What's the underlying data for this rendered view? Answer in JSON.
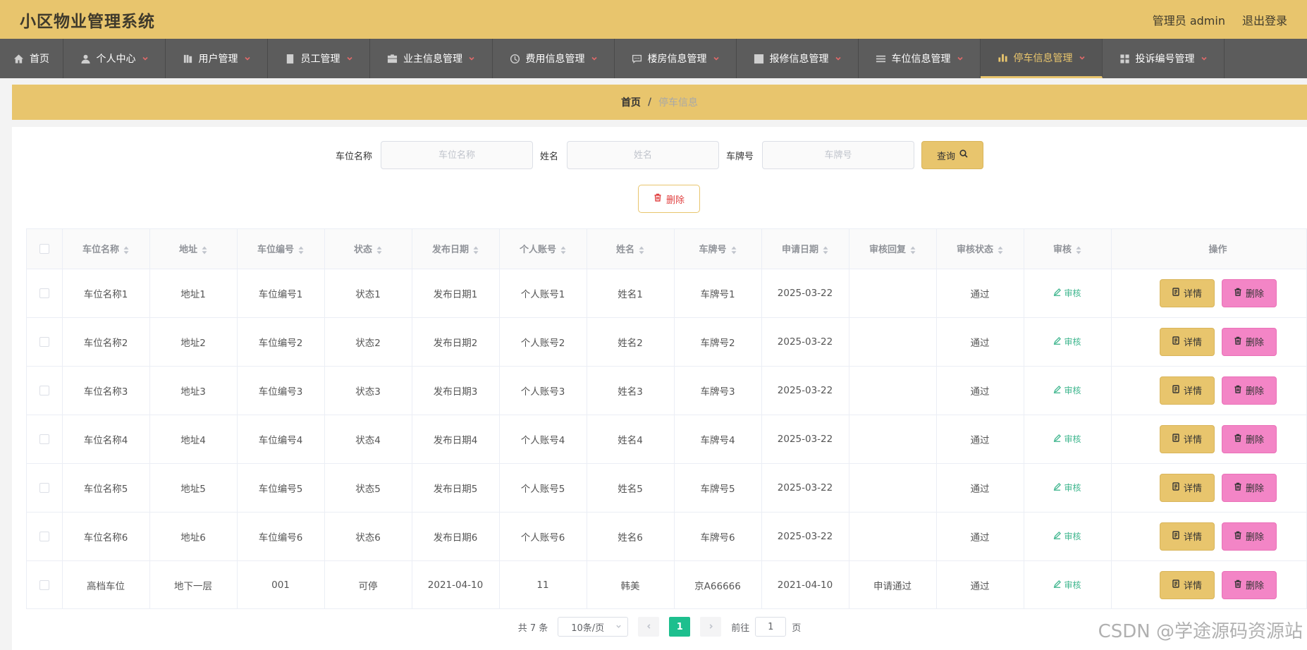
{
  "app": {
    "title": "小区物业管理系统"
  },
  "header": {
    "user": "管理员 admin",
    "logout": "退出登录"
  },
  "nav": [
    {
      "label": "首页",
      "icon": "home-icon",
      "dropdown": false
    },
    {
      "label": "个人中心",
      "icon": "user-icon",
      "dropdown": true
    },
    {
      "label": "用户管理",
      "icon": "book-icon",
      "dropdown": true
    },
    {
      "label": "员工管理",
      "icon": "badge-icon",
      "dropdown": true
    },
    {
      "label": "业主信息管理",
      "icon": "briefcase-icon",
      "dropdown": true
    },
    {
      "label": "费用信息管理",
      "icon": "clock-icon",
      "dropdown": true
    },
    {
      "label": "楼房信息管理",
      "icon": "chat-icon",
      "dropdown": true
    },
    {
      "label": "报修信息管理",
      "icon": "chart-line-icon",
      "dropdown": true
    },
    {
      "label": "车位信息管理",
      "icon": "menu-icon",
      "dropdown": true
    },
    {
      "label": "停车信息管理",
      "icon": "bar-chart-icon",
      "dropdown": true,
      "active": true
    },
    {
      "label": "投诉编号管理",
      "icon": "grid-icon",
      "dropdown": true
    }
  ],
  "breadcrumb": {
    "home": "首页",
    "separator": "/",
    "current": "停车信息"
  },
  "search": {
    "fields": [
      {
        "label": "车位名称",
        "placeholder": "车位名称",
        "value": ""
      },
      {
        "label": "姓名",
        "placeholder": "姓名",
        "value": ""
      },
      {
        "label": "车牌号",
        "placeholder": "车牌号",
        "value": ""
      }
    ],
    "query_label": "查询"
  },
  "bulk_delete_label": "删除",
  "table": {
    "columns": [
      "车位名称",
      "地址",
      "车位编号",
      "状态",
      "发布日期",
      "个人账号",
      "姓名",
      "车牌号",
      "申请日期",
      "审核回复",
      "审核状态",
      "审核",
      "操作"
    ],
    "review_label": "审核",
    "detail_label": "详情",
    "delete_label": "删除",
    "rows": [
      [
        "车位名称1",
        "地址1",
        "车位编号1",
        "状态1",
        "发布日期1",
        "个人账号1",
        "姓名1",
        "车牌号1",
        "2025-03-22",
        "",
        "通过"
      ],
      [
        "车位名称2",
        "地址2",
        "车位编号2",
        "状态2",
        "发布日期2",
        "个人账号2",
        "姓名2",
        "车牌号2",
        "2025-03-22",
        "",
        "通过"
      ],
      [
        "车位名称3",
        "地址3",
        "车位编号3",
        "状态3",
        "发布日期3",
        "个人账号3",
        "姓名3",
        "车牌号3",
        "2025-03-22",
        "",
        "通过"
      ],
      [
        "车位名称4",
        "地址4",
        "车位编号4",
        "状态4",
        "发布日期4",
        "个人账号4",
        "姓名4",
        "车牌号4",
        "2025-03-22",
        "",
        "通过"
      ],
      [
        "车位名称5",
        "地址5",
        "车位编号5",
        "状态5",
        "发布日期5",
        "个人账号5",
        "姓名5",
        "车牌号5",
        "2025-03-22",
        "",
        "通过"
      ],
      [
        "车位名称6",
        "地址6",
        "车位编号6",
        "状态6",
        "发布日期6",
        "个人账号6",
        "姓名6",
        "车牌号6",
        "2025-03-22",
        "",
        "通过"
      ],
      [
        "高档车位",
        "地下一层",
        "001",
        "可停",
        "2021-04-10",
        "11",
        "韩美",
        "京A66666",
        "2021-04-10",
        "申请通过",
        "通过"
      ]
    ]
  },
  "pagination": {
    "total": "共 7 条",
    "page_size": "10条/页",
    "current_page": "1",
    "goto_label": "前往",
    "goto_value": "1",
    "goto_suffix": "页"
  },
  "watermark": "CSDN @学途源码资源站",
  "colors": {
    "accent": "#e8c56d",
    "nav_bg": "#5c5c5c",
    "delete_pink": "#f385c6",
    "review_green": "#3fb68e",
    "page_active": "#1dbf8e"
  }
}
